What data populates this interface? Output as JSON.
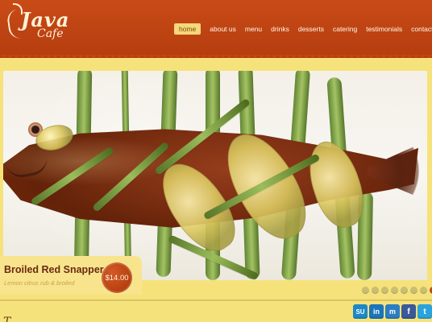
{
  "brand": {
    "name": "Java Cafe",
    "line_1": "Java",
    "line_2": "Cafe"
  },
  "nav": {
    "items": [
      {
        "label": "home",
        "active": true
      },
      {
        "label": "about us",
        "active": false
      },
      {
        "label": "menu",
        "active": false
      },
      {
        "label": "drinks",
        "active": false
      },
      {
        "label": "desserts",
        "active": false
      },
      {
        "label": "catering",
        "active": false
      },
      {
        "label": "testimonials",
        "active": false
      },
      {
        "label": "contact",
        "active": false
      }
    ]
  },
  "hero": {
    "title": "Broiled Red Snapper",
    "subtitle": "Lemon citrus rub & broiled",
    "price": "$14.00",
    "image_icon": "food-image"
  },
  "slider": {
    "current_slide": 8,
    "total_slides": 8
  },
  "social": {
    "icons": [
      {
        "name": "stumbleupon-icon",
        "label": "SU"
      },
      {
        "name": "linkedin-icon",
        "label": "in"
      },
      {
        "name": "myspace-icon",
        "label": "m"
      },
      {
        "name": "facebook-icon",
        "label": "f"
      },
      {
        "name": "twitter-icon",
        "label": "t"
      }
    ]
  },
  "footer": {
    "partial_heading": "T..."
  },
  "colors": {
    "header": "#b53d0f",
    "background": "#f6e27a",
    "accent": "#bf4c18",
    "nav_active": "#f4d87a"
  }
}
